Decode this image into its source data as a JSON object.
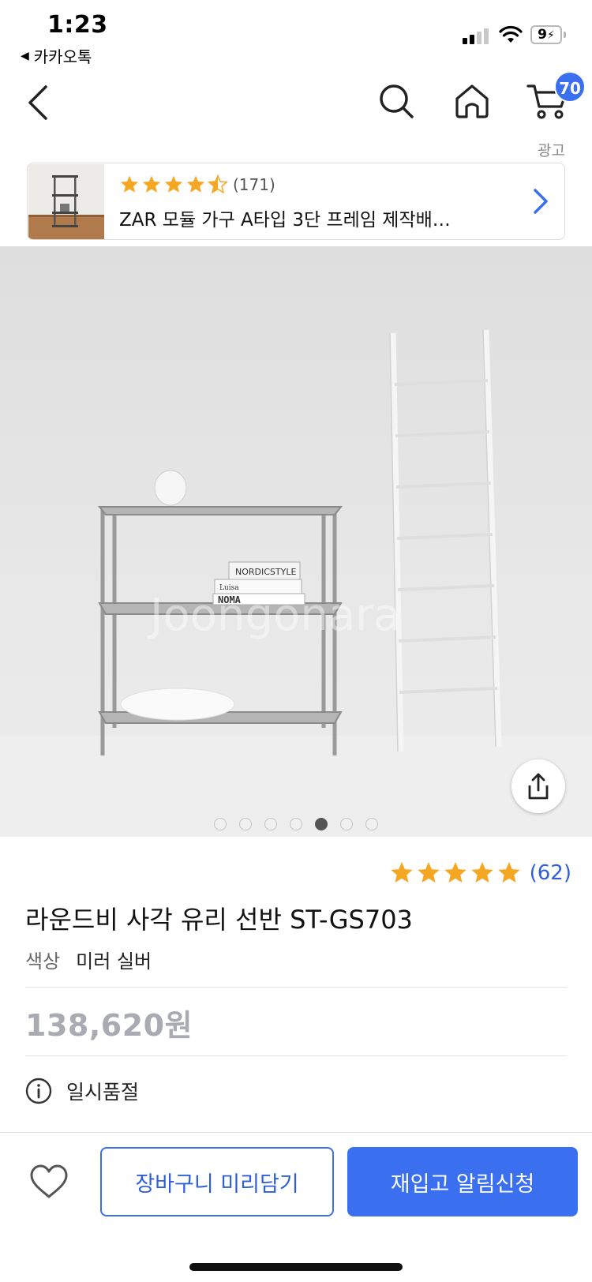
{
  "status_bar": {
    "time": "1:23",
    "back_app": "카카오톡",
    "battery": "9"
  },
  "nav": {
    "cart_count": "70"
  },
  "ad": {
    "label": "광고",
    "rating_count": "(171)",
    "title": "ZAR 모듈 가구 A타입 3단 프레임 제작배…",
    "rating": 4.5
  },
  "product": {
    "rating": 5,
    "rating_count": "(62)",
    "title": "라운드비 사각 유리 선반 ST-GS703",
    "option_label": "색상",
    "option_value": "미러 실버",
    "price": "138,620원",
    "stock_status": "일시품절",
    "image_count": 7,
    "active_image_index": 5,
    "image_texts": {
      "book1": "NORDICSTYLE",
      "book2_small": "Luisa",
      "book2": "NOMA"
    },
    "watermark": "Joongonara"
  },
  "actions": {
    "cart_label": "장바구니 미리담기",
    "notify_label": "재입고 알림신청"
  },
  "colors": {
    "accent": "#3a6ff0",
    "star": "#f5a623",
    "price_muted": "#a8acb2"
  }
}
